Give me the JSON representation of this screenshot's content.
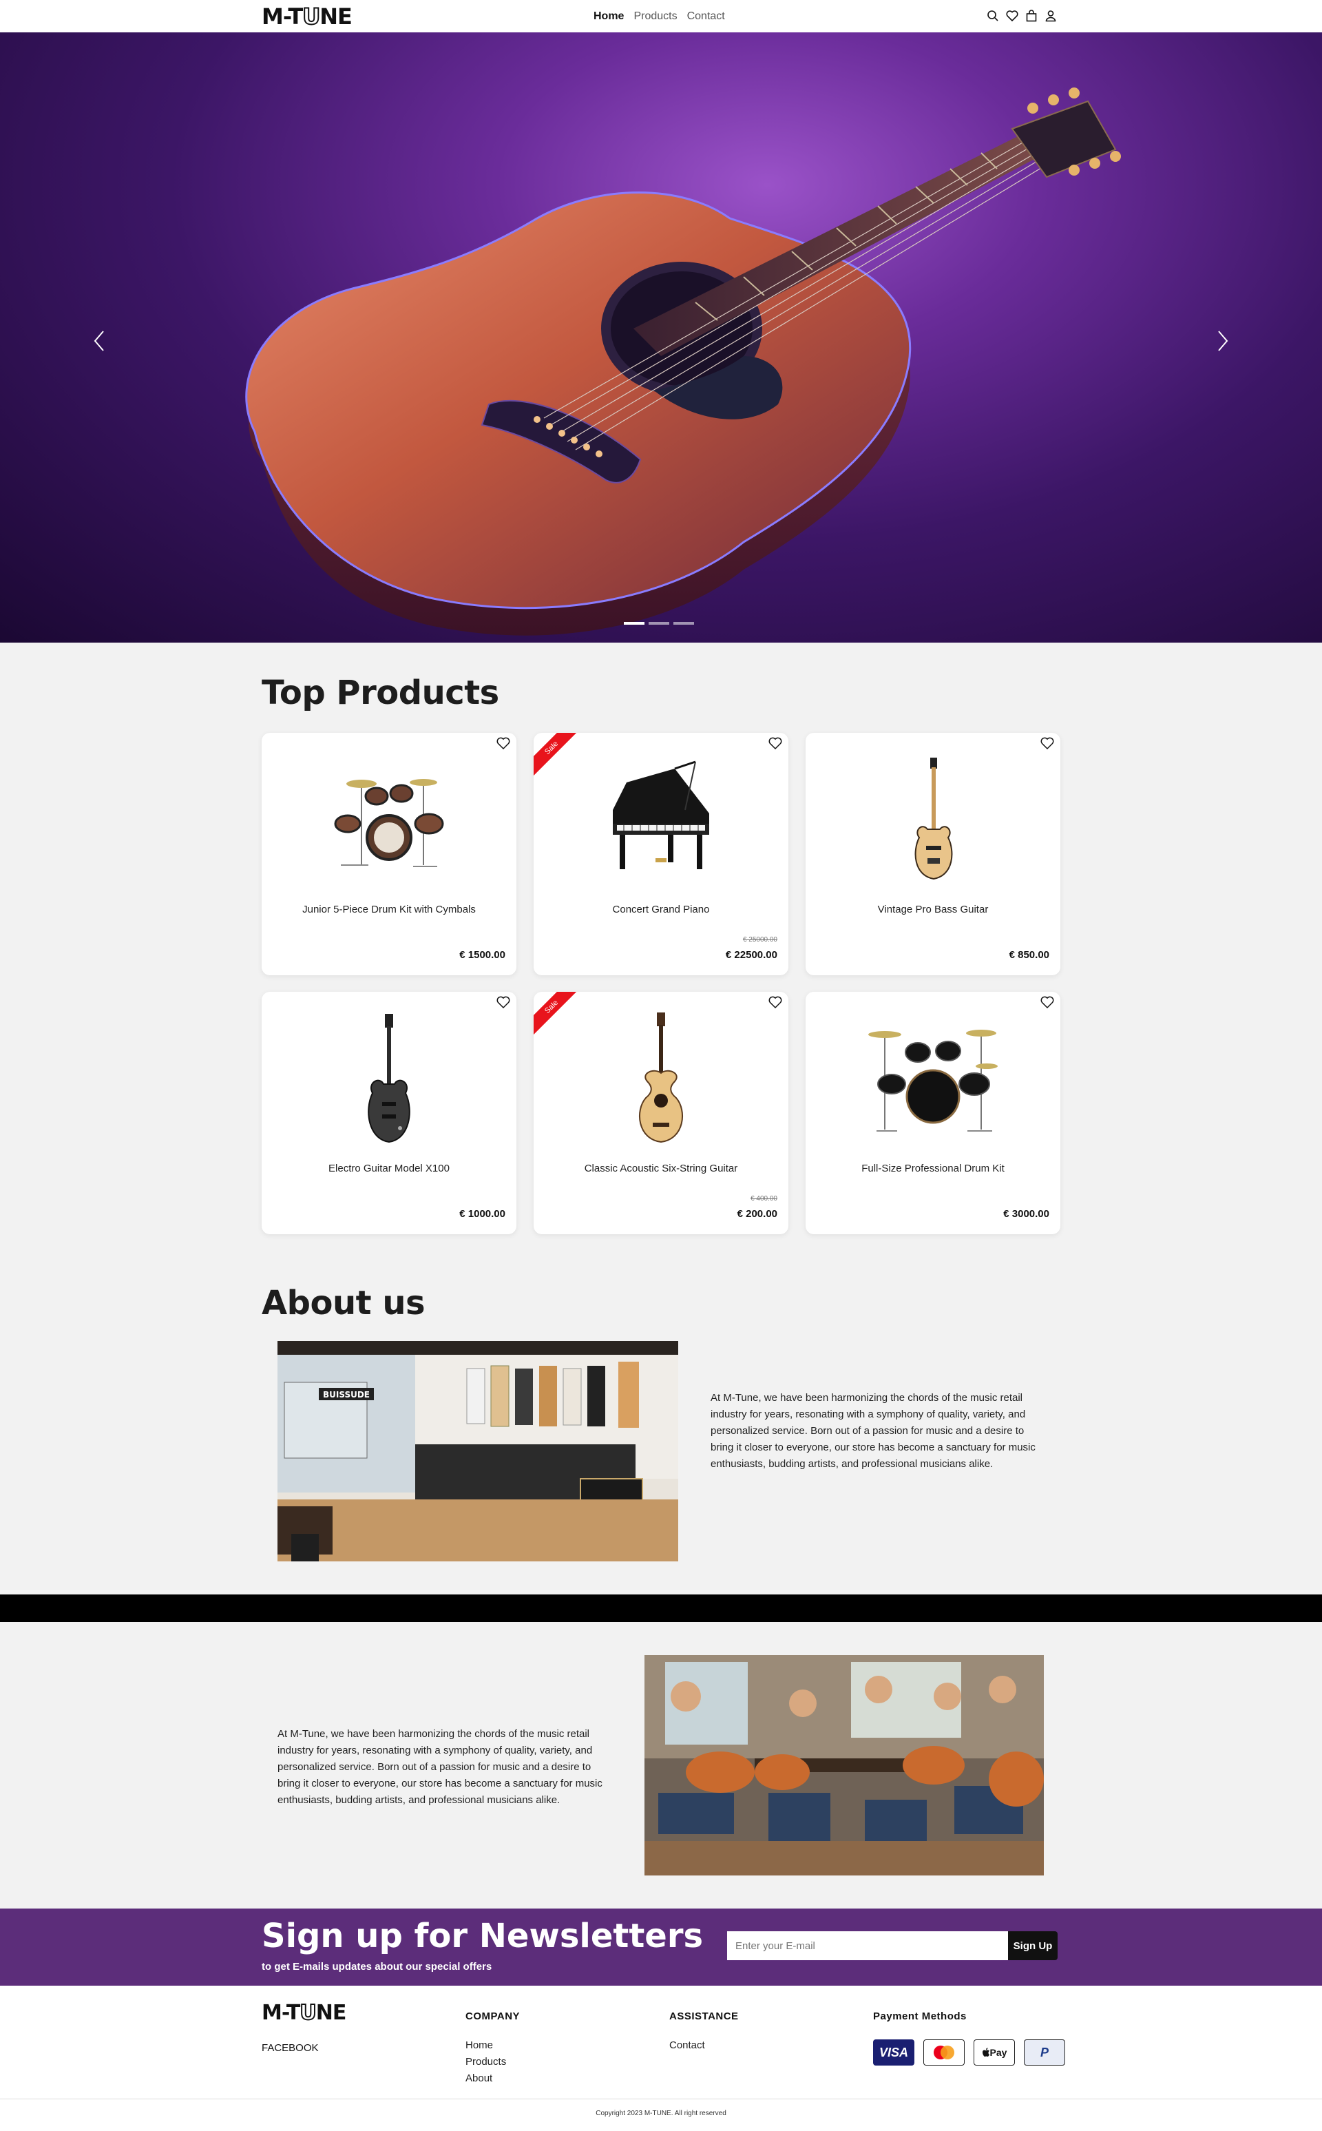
{
  "header": {
    "logo_text_a": "M-T",
    "logo_text_b": "U",
    "logo_text_c": "NE",
    "nav": [
      {
        "label": "Home",
        "active": true
      },
      {
        "label": "Products",
        "active": false
      },
      {
        "label": "Contact",
        "active": false
      }
    ],
    "icons": [
      "search-icon",
      "heart-icon",
      "bag-icon",
      "user-icon"
    ]
  },
  "hero": {
    "slides_total": 3,
    "active_slide": 1,
    "image": "acoustic guitar on purple background"
  },
  "top_products": {
    "title": "Top Products",
    "items": [
      {
        "name": "Junior 5-Piece Drum Kit with Cymbals",
        "price": "€ 1500.00",
        "old_price": "",
        "sale": false,
        "sale_label": "",
        "icon": "drum-kit-icon"
      },
      {
        "name": "Concert Grand Piano",
        "price": "€ 22500.00",
        "old_price": "€ 25000.00",
        "sale": true,
        "sale_label": "Sale",
        "icon": "grand-piano-icon"
      },
      {
        "name": "Vintage Pro Bass Guitar",
        "price": "€ 850.00",
        "old_price": "",
        "sale": false,
        "sale_label": "",
        "icon": "bass-guitar-icon"
      },
      {
        "name": "Electro Guitar Model X100",
        "price": "€ 1000.00",
        "old_price": "",
        "sale": false,
        "sale_label": "",
        "icon": "electric-guitar-icon"
      },
      {
        "name": "Classic Acoustic Six-String Guitar",
        "price": "€ 200.00",
        "old_price": "€ 400.00",
        "sale": true,
        "sale_label": "Sale",
        "icon": "acoustic-guitar-icon"
      },
      {
        "name": "Full-Size Professional Drum Kit",
        "price": "€ 3000.00",
        "old_price": "",
        "sale": false,
        "sale_label": "",
        "icon": "drum-kit-icon"
      }
    ]
  },
  "about": {
    "title": "About us",
    "store_sign": "BUISSUDE",
    "text": "At M-Tune, we have been harmonizing the chords of the music retail industry for years, resonating with a symphony of quality, variety, and personalized service. Born out of a passion for music and a desire to bring it closer to everyone, our store has become a sanctuary for music enthusiasts, budding artists, and professional musicians alike.",
    "text2": "At M-Tune, we have been harmonizing the chords of the music retail industry for years, resonating with a symphony of quality, variety, and personalized service. Born out of a passion for music and a desire to bring it closer to everyone, our store has become a sanctuary for music enthusiasts, budding artists, and professional musicians alike."
  },
  "newsletter": {
    "title": "Sign up for Newsletters",
    "subtitle": "to get E-mails updates about our special offers",
    "input_placeholder": "Enter your E-mail",
    "button_label": "Sign Up",
    "bg_color": "#5c2d7a"
  },
  "footer": {
    "logo_text_a": "M-T",
    "logo_text_b": "U",
    "logo_text_c": "NE",
    "social": "FACEBOOK",
    "company": {
      "title": "COMPANY",
      "links": [
        "Home",
        "Products",
        "About"
      ]
    },
    "assistance": {
      "title": "ASSISTANCE",
      "links": [
        "Contact"
      ]
    },
    "payment": {
      "title": "Payment Methods",
      "methods": [
        {
          "label": "VISA",
          "icon": "visa-icon"
        },
        {
          "label": "",
          "icon": "mastercard-icon"
        },
        {
          "label": "Pay",
          "icon": "apple-pay-icon"
        },
        {
          "label": "P",
          "icon": "paypal-icon"
        }
      ]
    },
    "copyright": "Copyright 2023 M-TUNE. All right reserved"
  }
}
